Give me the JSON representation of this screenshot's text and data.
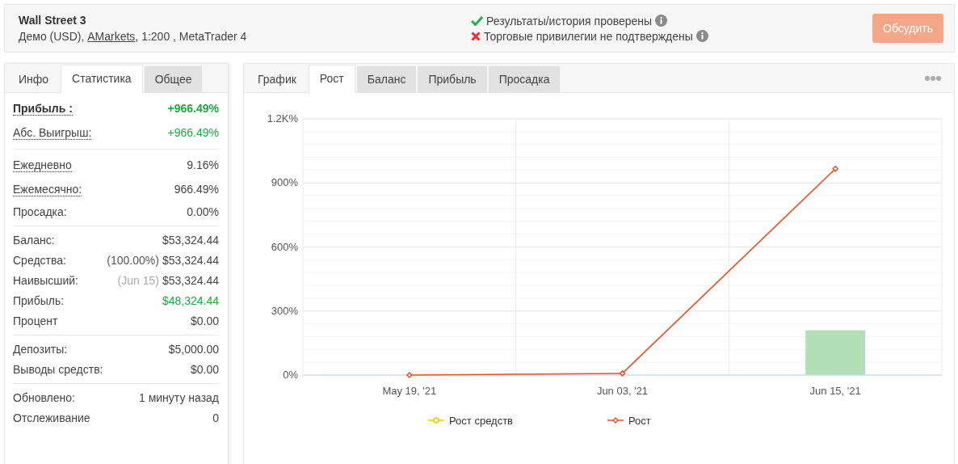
{
  "header": {
    "title": "Wall Street 3",
    "subtitle_before": "Демо (USD), ",
    "broker_link": "AMarkets",
    "subtitle_after": ", 1:200 , MetaTrader 4",
    "checks": [
      {
        "label": "Результаты/история проверены",
        "verified": true
      },
      {
        "label": "Торговые привилегии не подтверждены",
        "verified": false
      }
    ],
    "button": "Обсудить"
  },
  "left_tabs": [
    {
      "label": "Инфо",
      "selected": false,
      "kind": "plain"
    },
    {
      "label": "Статистика",
      "selected": true,
      "kind": "plain"
    },
    {
      "label": "Общее",
      "selected": false,
      "kind": "grey"
    }
  ],
  "stats": [
    [
      {
        "label": "Прибыль :",
        "value": "+966.49%",
        "bold": true,
        "dotted": true,
        "positive": true
      },
      {
        "label": "Абс. Выигрыш:",
        "value": "+966.49%",
        "bold": false,
        "dotted": true,
        "positive": true
      }
    ],
    [
      {
        "label": "Ежедневно",
        "value": "9.16%",
        "bold": false,
        "dotted": true,
        "positive": false
      },
      {
        "label": "Ежемесячно:",
        "value": "966.49%",
        "bold": false,
        "dotted": true,
        "positive": false
      },
      {
        "label": "Просадка:",
        "value": "0.00%",
        "bold": false,
        "dotted": false,
        "positive": false
      }
    ],
    [
      {
        "label": "Баланс:",
        "value": "$53,324.44",
        "bold": false,
        "dotted": false,
        "positive": false
      },
      {
        "label": "Средства:",
        "note": "(100.00%)",
        "note_muted": false,
        "value": "$53,324.44",
        "bold": false,
        "dotted": false,
        "positive": false
      },
      {
        "label": "Наивысший:",
        "note": "(Jun 15)",
        "note_muted": true,
        "value": "$53,324.44",
        "bold": false,
        "dotted": false,
        "positive": false
      },
      {
        "label": "Прибыль:",
        "value": "$48,324.44",
        "bold": false,
        "dotted": false,
        "positive": true
      },
      {
        "label": "Процент",
        "value": "$0.00",
        "bold": false,
        "dotted": false,
        "positive": false
      }
    ],
    [
      {
        "label": "Депозиты:",
        "value": "$5,000.00",
        "bold": false,
        "dotted": false,
        "positive": false
      },
      {
        "label": "Выводы средств:",
        "value": "$0.00",
        "bold": false,
        "dotted": false,
        "positive": false
      }
    ],
    [
      {
        "label": "Обновлено:",
        "value": "1 минуту назад",
        "bold": false,
        "dotted": false,
        "positive": false
      },
      {
        "label": "Отслеживание",
        "value": "0",
        "bold": false,
        "dotted": false,
        "positive": false
      }
    ]
  ],
  "right_tabs": [
    {
      "label": "График",
      "selected": false,
      "kind": "plain"
    },
    {
      "label": "Рост",
      "selected": true,
      "kind": "plain"
    },
    {
      "label": "Баланс",
      "selected": false,
      "kind": "grey"
    },
    {
      "label": "Прибыль",
      "selected": false,
      "kind": "grey"
    },
    {
      "label": "Просадка",
      "selected": false,
      "kind": "grey"
    }
  ],
  "chart_data": {
    "type": "line",
    "categories": [
      "May 19, '21",
      "Jun 03, '21",
      "Jun 15, '21"
    ],
    "ylim": [
      0,
      1200
    ],
    "yticks": [
      {
        "value": 0,
        "label": "0%"
      },
      {
        "value": 300,
        "label": "300%"
      },
      {
        "value": 600,
        "label": "600%"
      },
      {
        "value": 900,
        "label": "900%"
      },
      {
        "value": 1200,
        "label": "1.2K%"
      }
    ],
    "series": [
      {
        "name": "Рост средств",
        "color": "#f5c400",
        "marker": "circle",
        "values": [
          null,
          null,
          null
        ]
      },
      {
        "name": "Рост",
        "color": "#f04e23",
        "marker": "diamond",
        "values": [
          0,
          8,
          966
        ]
      },
      {
        "color": "#b3dfb6",
        "type": "bar",
        "values": [
          0,
          null,
          210
        ]
      }
    ],
    "grid": true,
    "legend": true
  }
}
